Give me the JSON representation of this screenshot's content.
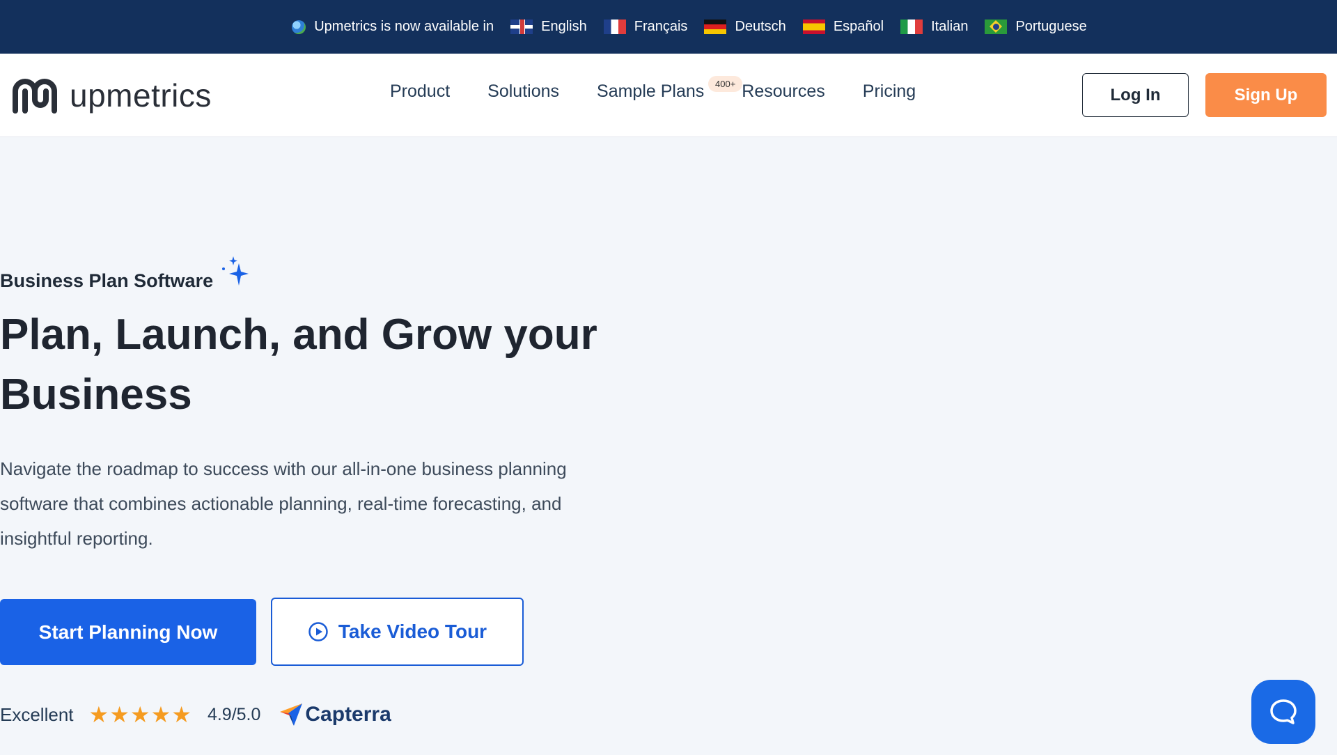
{
  "language_bar": {
    "text": "Upmetrics is now available in",
    "languages": [
      {
        "label": "English",
        "flag": "uk-flag-icon"
      },
      {
        "label": "Français",
        "flag": "france-flag-icon"
      },
      {
        "label": "Deutsch",
        "flag": "germany-flag-icon"
      },
      {
        "label": "Español",
        "flag": "spain-flag-icon"
      },
      {
        "label": "Italian",
        "flag": "italy-flag-icon"
      },
      {
        "label": "Portuguese",
        "flag": "portugal-flag-icon"
      }
    ]
  },
  "header": {
    "logo_text": "upmetrics",
    "nav": [
      "Product",
      "Solutions",
      "Sample Plans",
      "Resources",
      "Pricing"
    ],
    "sample_plans_badge": "400+",
    "login_label": "Log In",
    "signup_label": "Sign Up"
  },
  "hero": {
    "eyebrow": "Business Plan Software",
    "headline": "Plan, Launch, and Grow your Business",
    "description": "Navigate the roadmap to success with our all-in-one business planning software that combines actionable planning, real-time forecasting, and insightful reporting.",
    "primary_cta": "Start Planning Now",
    "secondary_cta": "Take Video Tour"
  },
  "rating": {
    "label": "Excellent",
    "stars": 5,
    "score": "4.9/5.0",
    "source": "Capterra"
  },
  "colors": {
    "top_bar": "#13305c",
    "primary": "#1a62e6",
    "signup": "#fa8c48",
    "star": "#f59b20"
  }
}
